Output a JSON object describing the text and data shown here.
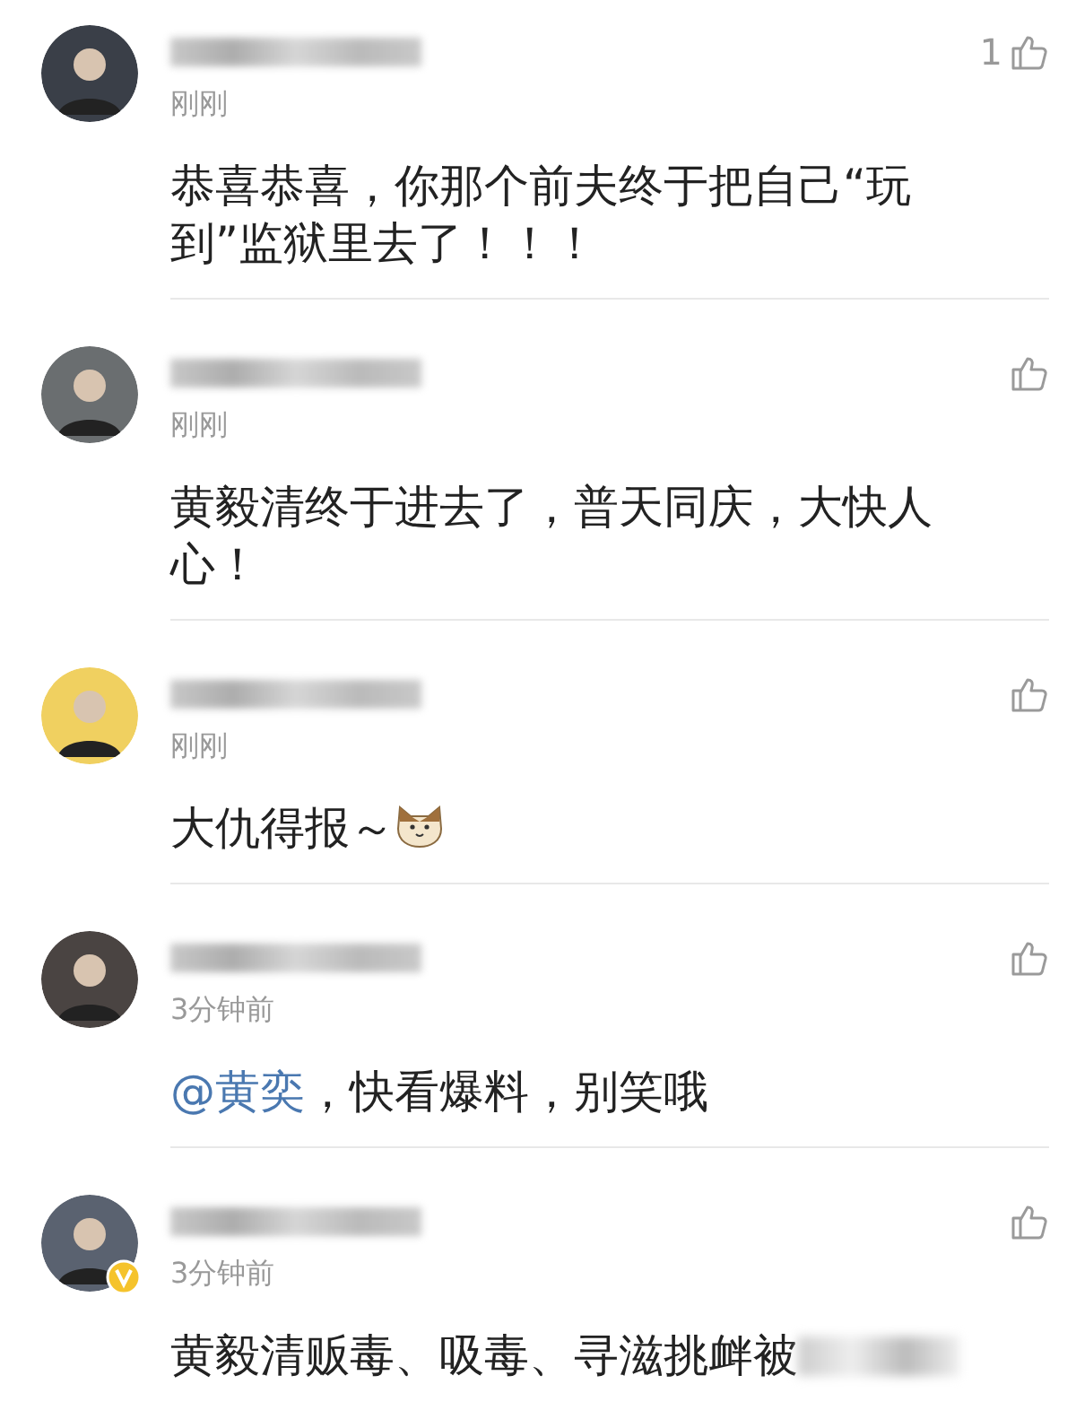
{
  "comments": [
    {
      "time": "刚刚",
      "text": "恭喜恭喜，你那个前夫终于把自己“玩到”监狱里去了！！！",
      "like_count": "1",
      "verified": false,
      "emoji": false
    },
    {
      "time": "刚刚",
      "text": "黄毅清终于进去了，普天同庆，大快人心！",
      "verified": false,
      "emoji": false
    },
    {
      "time": "刚刚",
      "text": "大仇得报～",
      "verified": false,
      "emoji": true
    },
    {
      "time": "3分钟前",
      "mention": "@黄奕",
      "text": "，快看爆料，别笑哦",
      "verified": false,
      "emoji": false
    },
    {
      "time": "3分钟前",
      "text": "黄毅清贩毒、吸毒、寻滋挑衅被",
      "verified": true,
      "emoji": false,
      "blurred_tail": true
    }
  ]
}
